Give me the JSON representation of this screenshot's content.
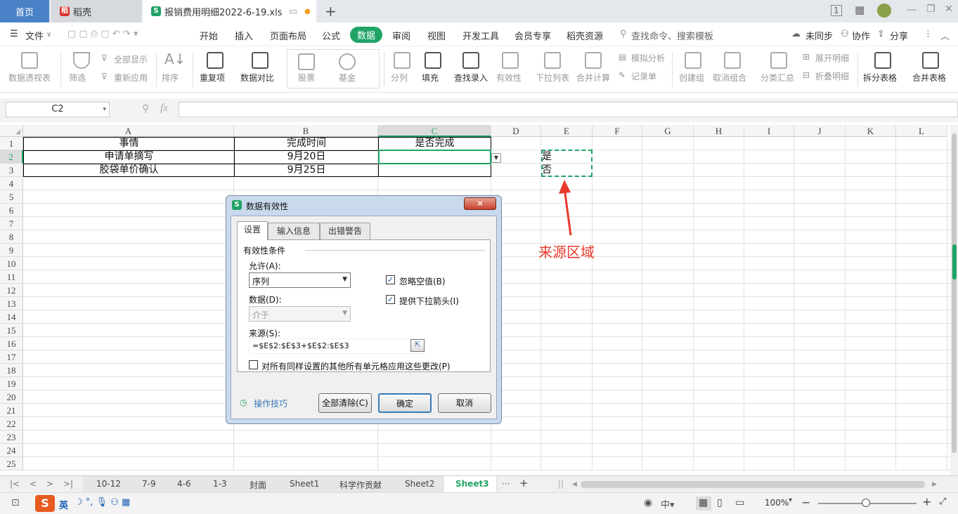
{
  "tabs": {
    "home": "首页",
    "daoke": "稻壳",
    "doc": "报销费用明细2022-6-19.xls"
  },
  "menu": {
    "file": "文件",
    "items": [
      "开始",
      "插入",
      "页面布局",
      "公式",
      "数据",
      "审阅",
      "视图",
      "开发工具",
      "会员专享",
      "稻壳资源"
    ],
    "search": "查找命令、搜索模板",
    "sync": "未同步",
    "collab": "协作",
    "share": "分享"
  },
  "ribbon": {
    "pivot": "数据透视表",
    "filter": "筛选",
    "show_all": "全部显示",
    "reapply": "重新应用",
    "sort": "排序",
    "dup": "重复项",
    "compare": "数据对比",
    "stock": "股票",
    "fund": "基金",
    "split": "分列",
    "fill": "填充",
    "lookup": "查找录入",
    "validity": "有效性",
    "dropdown": "下拉列表",
    "consolidate": "合并计算",
    "simulate": "模拟分析",
    "record": "记录单",
    "group": "创建组",
    "ungroup": "取消组合",
    "subtotal": "分类汇总",
    "expand": "展开明细",
    "collapse": "折叠明细",
    "split_table": "拆分表格",
    "merge_table": "合并表格"
  },
  "namebox": "C2",
  "columns": [
    "A",
    "B",
    "C",
    "D",
    "E",
    "F",
    "G",
    "H",
    "I",
    "J",
    "K",
    "L"
  ],
  "rows": [
    "1",
    "2",
    "3",
    "4",
    "5",
    "6",
    "7",
    "8",
    "9",
    "10",
    "11",
    "12",
    "13",
    "14",
    "15",
    "16",
    "17",
    "18",
    "19",
    "20",
    "21",
    "22",
    "23",
    "24",
    "25"
  ],
  "cells": {
    "a1": "事情",
    "b1": "完成时间",
    "c1": "是否完成",
    "a2": "申请单摘写",
    "b2": "9月20日",
    "a3": "胶袋单价确认",
    "b3": "9月25日",
    "e2": "是",
    "e3": "否"
  },
  "annotation": "来源区域",
  "dialog": {
    "title": "数据有效性",
    "tabs": [
      "设置",
      "输入信息",
      "出错警告"
    ],
    "section": "有效性条件",
    "allow_label": "允许(A):",
    "allow_value": "序列",
    "ignore_blank": "忽略空值(B)",
    "dropdown_arrow": "提供下拉箭头(I)",
    "data_label": "数据(D):",
    "data_value": "介于",
    "source_label": "来源(S):",
    "source_value": "=$E$2:$E$3+$E$2:$E$3",
    "apply_all": "对所有同样设置的其他所有单元格应用这些更改(P)",
    "tips": "操作技巧",
    "clear_all": "全部清除(C)",
    "ok": "确定",
    "cancel": "取消"
  },
  "sheet_tabs": [
    "10-12",
    "7-9",
    "4-6",
    "1-3",
    "封面",
    "Sheet1",
    "科学作贡献",
    "Sheet2",
    "Sheet3"
  ],
  "status": {
    "zoom": "100%",
    "ime": "英"
  },
  "colors": {
    "accent": "#1fa466",
    "home_tab": "#4a82c8",
    "annotation": "#e8392c"
  }
}
